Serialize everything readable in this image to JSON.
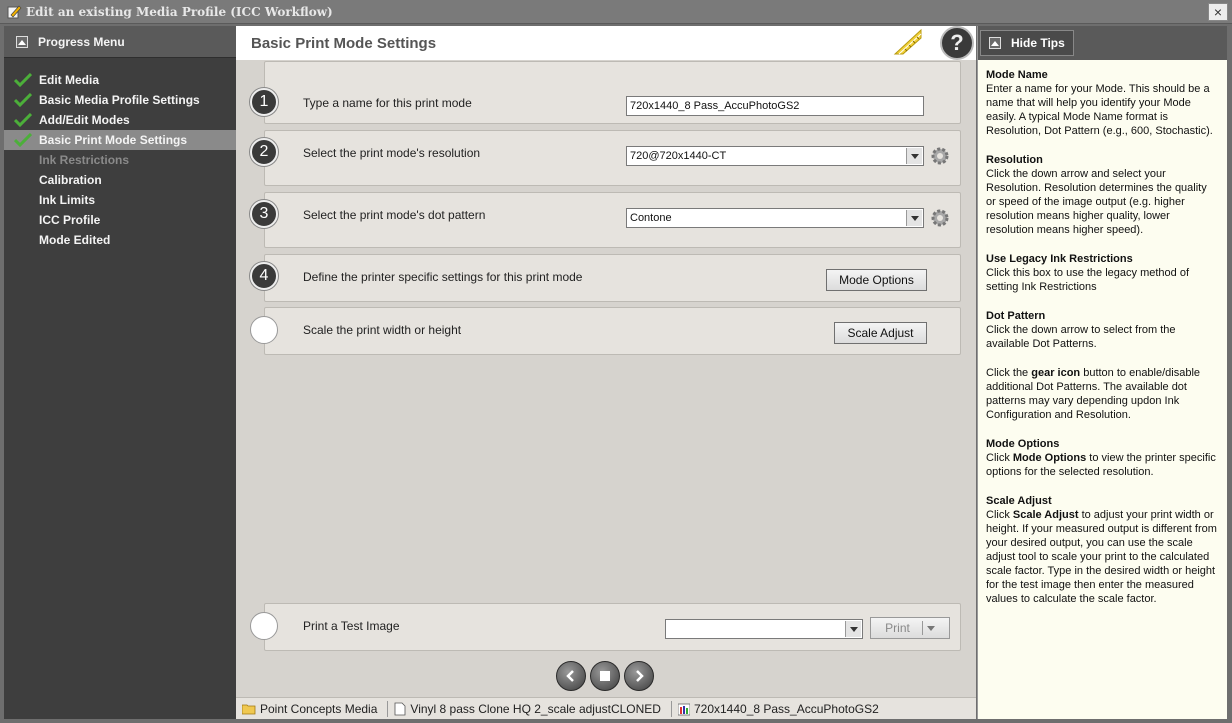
{
  "window": {
    "title": "Edit an existing Media Profile (ICC Workflow)",
    "close_label": "×"
  },
  "sidebar": {
    "header": "Progress Menu",
    "items": [
      {
        "label": "Edit Media",
        "done": true
      },
      {
        "label": "Basic Media Profile Settings",
        "done": true
      },
      {
        "label": "Add/Edit Modes",
        "done": true
      },
      {
        "label": "Basic Print Mode Settings",
        "done": true,
        "active": true
      },
      {
        "label": "Ink Restrictions",
        "disabled": true
      },
      {
        "label": "Calibration"
      },
      {
        "label": "Ink Limits"
      },
      {
        "label": "ICC Profile"
      },
      {
        "label": "Mode Edited"
      }
    ]
  },
  "main": {
    "title": "Basic Print Mode Settings",
    "help_label": "?",
    "steps": [
      {
        "num": "1",
        "label": "Type a name for this print mode",
        "value": "720x1440_8 Pass_AccuPhotoGS2"
      },
      {
        "num": "2",
        "label": "Select the print mode's resolution",
        "value": "720@720x1440-CT"
      },
      {
        "num": "3",
        "label": "Select the print mode's dot pattern",
        "value": "Contone"
      },
      {
        "num": "4",
        "label": "Define the printer specific settings for this print mode",
        "button": "Mode Options"
      },
      {
        "num": "",
        "label": "Scale the print width or height",
        "button": "Scale Adjust"
      },
      {
        "num": "",
        "label": "Print a Test Image",
        "value": "",
        "button": "Print"
      }
    ]
  },
  "statusbar": {
    "media": "Point Concepts Media",
    "profile": "Vinyl 8 pass Clone HQ 2_scale adjustCLONED",
    "mode": "720x1440_8 Pass_AccuPhotoGS2"
  },
  "tips": {
    "hide_label": "Hide Tips",
    "sections": {
      "mode_name": {
        "head": "Mode Name",
        "text": "Enter a name for your Mode. This should be a name that will help you identify your Mode easily. A typical Mode Name format is Resolution, Dot Pattern (e.g., 600, Stochastic)."
      },
      "resolution": {
        "head": "Resolution",
        "text": "Click the down arrow and select your Resolution. Resolution determines the quality or speed of the image output (e.g. higher resolution means higher quality, lower resolution means higher speed)."
      },
      "legacy": {
        "head": "Use Legacy Ink Restrictions",
        "text": "Click this box to use the legacy method of setting Ink Restrictions"
      },
      "dot_pattern": {
        "head": "Dot Pattern",
        "text": "Click the down arrow to select from the available Dot Patterns."
      },
      "gear": {
        "pre": "Click the ",
        "bold": "gear icon",
        "post": " button to enable/disable additional Dot Patterns. The available dot patterns may vary depending updon Ink Configuration and Resolution."
      },
      "mode_options": {
        "head": "Mode Options",
        "pre": "Click ",
        "bold": "Mode Options",
        "post": " to view the printer specific options for the selected resolution."
      },
      "scale_adjust": {
        "head": "Scale Adjust",
        "pre": "Click ",
        "bold": "Scale Adjust",
        "post": " to adjust your print width or height. If your measured output is different from your desired output, you can use the scale adjust tool to scale your print to the calculated scale factor. Type in the desired width or height for the test image then enter the measured values to calculate the scale factor."
      }
    }
  },
  "colors": {
    "sidebar_bg": "#3e3e3e",
    "active_item": "#8a8a8a",
    "check_green": "#4caf3a",
    "main_bg": "#d6d3ce",
    "tips_bg": "#fdfdf0",
    "ruler_yellow": "#f2d23a"
  }
}
